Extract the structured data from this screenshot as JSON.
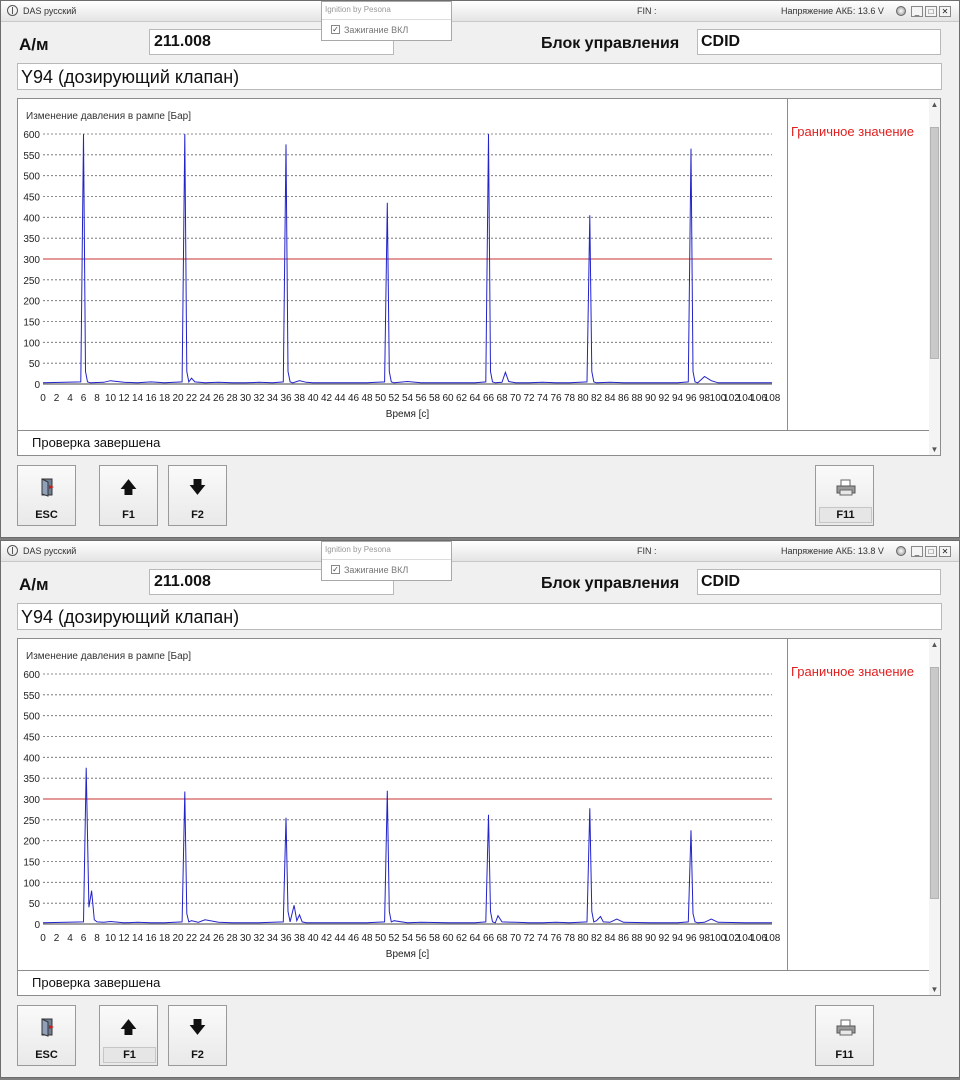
{
  "windows": [
    {
      "app_title": "DAS русский",
      "fin": "FIN :",
      "voltage": "Напряжение АКБ: 13.6 V",
      "popup": {
        "title": "Ignition by Pesona",
        "checkbox_label": "Зажигание ВКЛ",
        "checked": true
      },
      "vehicle_label": "А/м",
      "vehicle_value": "211.008",
      "ecu_label": "Блок управления",
      "ecu_value": "CDID",
      "component": "Y94 (дозирующий клапан)",
      "status": "Проверка завершена",
      "limit_label": "Граничное значение",
      "selected_key": "F11",
      "keys": {
        "esc": "ESC",
        "f1": "F1",
        "f2": "F2",
        "f11": "F11"
      },
      "chart_data": {
        "type": "line",
        "title": "Изменение давления в рампе [Бар]",
        "xlabel": "Время [с]",
        "ylabel": "",
        "xlim": [
          0,
          108
        ],
        "ylim": [
          0,
          600
        ],
        "x_ticks": [
          0,
          2,
          4,
          6,
          8,
          10,
          12,
          14,
          16,
          18,
          20,
          22,
          24,
          26,
          28,
          30,
          32,
          34,
          36,
          38,
          40,
          42,
          44,
          46,
          48,
          50,
          52,
          54,
          56,
          58,
          60,
          62,
          64,
          66,
          68,
          70,
          72,
          74,
          76,
          78,
          80,
          82,
          84,
          86,
          88,
          90,
          92,
          94,
          96,
          98,
          100,
          102,
          104,
          106,
          108
        ],
        "y_ticks": [
          0,
          50,
          100,
          150,
          200,
          250,
          300,
          350,
          400,
          450,
          500,
          550,
          600
        ],
        "grid": true,
        "colors": {
          "series": "#2323c8",
          "limit": "#c83232"
        },
        "limit": 300,
        "series": [
          {
            "x": [
              0,
              5.6,
              6.0,
              6.3,
              6.6,
              7,
              9,
              10,
              12,
              14,
              16,
              18,
              20.6,
              21.0,
              21.3,
              21.6,
              22,
              22.5,
              24,
              26,
              28,
              30,
              32,
              34,
              35.6,
              36.0,
              36.3,
              36.6,
              37,
              38,
              39,
              40,
              44,
              48,
              50.6,
              51.0,
              51.3,
              51.6,
              52,
              54,
              56,
              60,
              64,
              65.6,
              66.0,
              66.3,
              66.6,
              67,
              68,
              68.5,
              69,
              70,
              72,
              74,
              76,
              78,
              80.6,
              81.0,
              81.3,
              81.6,
              82,
              84,
              86,
              90,
              94,
              95.6,
              96.0,
              96.3,
              96.6,
              97,
              98,
              99,
              100,
              104,
              108
            ],
            "y": [
              3,
              5,
              600,
              30,
              5,
              3,
              4,
              8,
              4,
              3,
              5,
              3,
              5,
              600,
              30,
              5,
              14,
              5,
              3,
              4,
              3,
              3,
              4,
              3,
              5,
              575,
              30,
              5,
              3,
              8,
              4,
              3,
              3,
              3,
              5,
              435,
              30,
              5,
              3,
              6,
              3,
              3,
              3,
              5,
              600,
              30,
              5,
              3,
              4,
              28,
              6,
              3,
              3,
              4,
              3,
              3,
              5,
              405,
              30,
              5,
              3,
              4,
              3,
              3,
              3,
              5,
              565,
              30,
              5,
              3,
              18,
              8,
              3,
              3,
              3
            ]
          }
        ]
      }
    },
    {
      "app_title": "DAS русский",
      "fin": "FIN :",
      "voltage": "Напряжение АКБ: 13.8 V",
      "popup": {
        "title": "Ignition by Pesona",
        "checkbox_label": "Зажигание ВКЛ",
        "checked": true
      },
      "vehicle_label": "А/м",
      "vehicle_value": "211.008",
      "ecu_label": "Блок управления",
      "ecu_value": "CDID",
      "component": "Y94 (дозирующий клапан)",
      "status": "Проверка завершена",
      "limit_label": "Граничное значение",
      "selected_key": "F1",
      "keys": {
        "esc": "ESC",
        "f1": "F1",
        "f2": "F2",
        "f11": "F11"
      },
      "chart_data": {
        "type": "line",
        "title": "Изменение давления в рампе [Бар]",
        "xlabel": "Время [с]",
        "ylabel": "",
        "xlim": [
          0,
          108
        ],
        "ylim": [
          0,
          600
        ],
        "x_ticks": [
          0,
          2,
          4,
          6,
          8,
          10,
          12,
          14,
          16,
          18,
          20,
          22,
          24,
          26,
          28,
          30,
          32,
          34,
          36,
          38,
          40,
          42,
          44,
          46,
          48,
          50,
          52,
          54,
          56,
          58,
          60,
          62,
          64,
          66,
          68,
          70,
          72,
          74,
          76,
          78,
          80,
          82,
          84,
          86,
          88,
          90,
          92,
          94,
          96,
          98,
          100,
          102,
          104,
          106,
          108
        ],
        "y_ticks": [
          0,
          50,
          100,
          150,
          200,
          250,
          300,
          350,
          400,
          450,
          500,
          550,
          600
        ],
        "grid": true,
        "colors": {
          "series": "#2323c8",
          "limit": "#c83232"
        },
        "limit": 300,
        "series": [
          {
            "x": [
              0,
              6.0,
              6.4,
              6.8,
              7.2,
              7.6,
              8.0,
              9,
              10,
              12,
              14,
              16,
              18,
              20.6,
              21.0,
              21.3,
              21.6,
              22,
              23,
              24,
              26,
              28,
              30,
              32,
              34,
              35.6,
              36.0,
              36.3,
              36.6,
              37.2,
              37.6,
              38.0,
              38.4,
              39,
              40,
              44,
              48,
              50.6,
              51.0,
              51.3,
              51.6,
              52,
              54,
              56,
              60,
              64,
              65.6,
              66.0,
              66.3,
              66.6,
              67,
              67.4,
              68,
              70,
              72,
              74,
              76,
              78,
              80.6,
              81.0,
              81.3,
              81.6,
              82,
              82.6,
              83,
              84,
              85,
              86,
              90,
              94,
              95.6,
              96.0,
              96.3,
              96.6,
              97,
              98,
              99,
              100,
              104,
              108
            ],
            "y": [
              3,
              5,
              375,
              40,
              80,
              10,
              5,
              4,
              6,
              3,
              4,
              3,
              3,
              5,
              318,
              25,
              5,
              8,
              4,
              10,
              4,
              3,
              3,
              3,
              4,
              5,
              255,
              30,
              5,
              45,
              8,
              22,
              5,
              3,
              3,
              3,
              3,
              5,
              320,
              30,
              5,
              8,
              3,
              4,
              3,
              3,
              5,
              262,
              30,
              5,
              3,
              20,
              5,
              4,
              3,
              3,
              4,
              3,
              5,
              278,
              30,
              5,
              8,
              18,
              5,
              4,
              12,
              4,
              3,
              3,
              5,
              225,
              25,
              5,
              3,
              4,
              12,
              4,
              3,
              3
            ]
          }
        ]
      }
    }
  ]
}
